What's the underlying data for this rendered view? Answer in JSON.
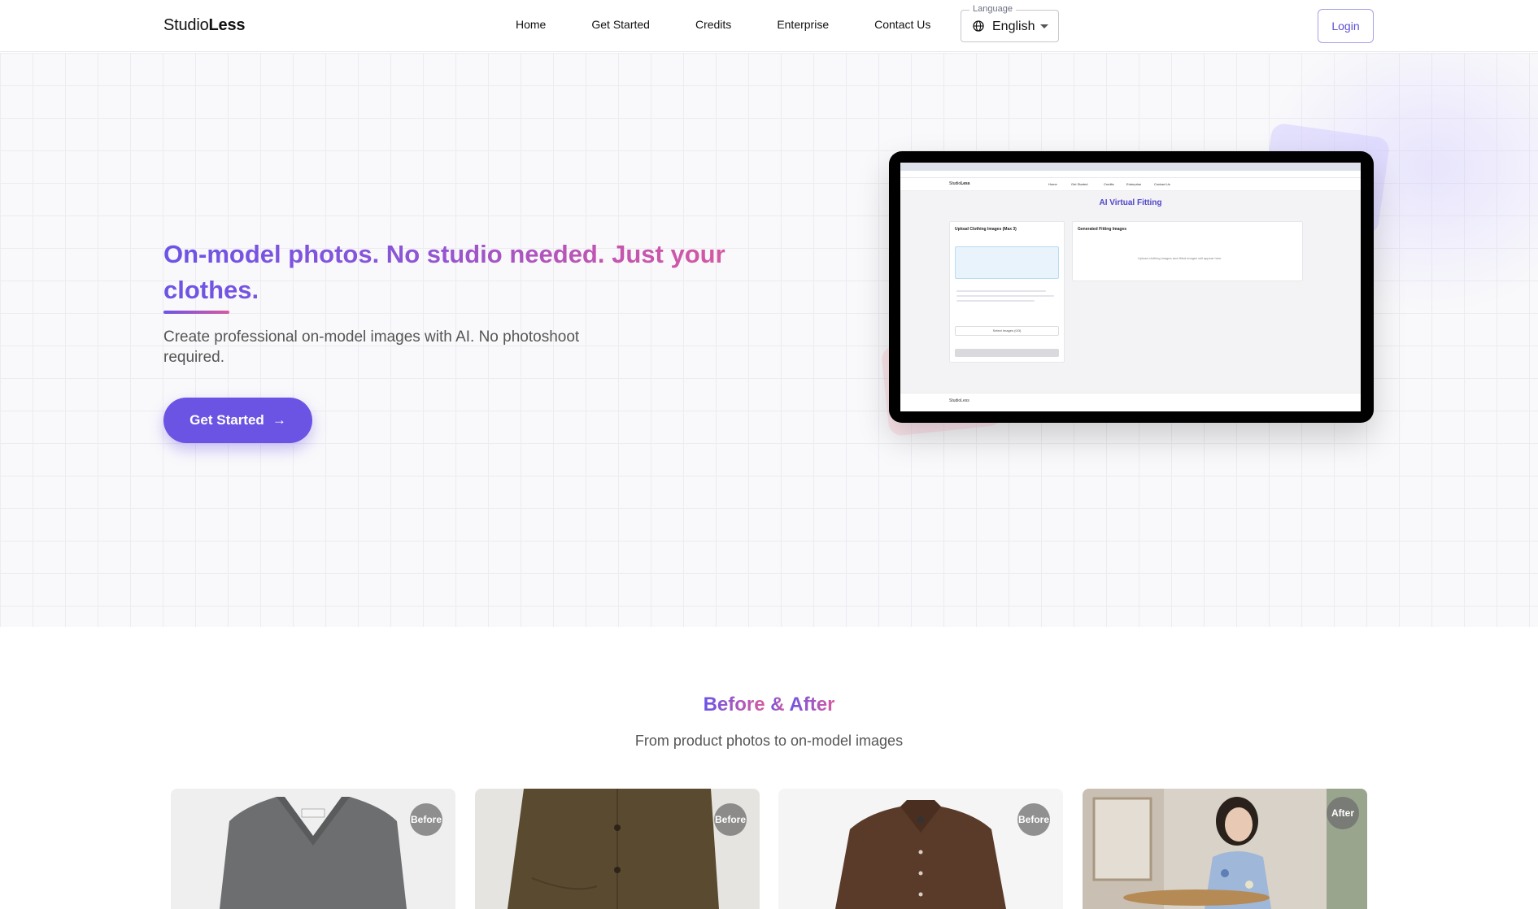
{
  "header": {
    "logo_regular": "Studio",
    "logo_bold": "Less",
    "nav": [
      "Home",
      "Get Started",
      "Credits",
      "Enterprise",
      "Contact Us"
    ],
    "language": {
      "legend": "Language",
      "value": "English",
      "icon": "globe-icon"
    },
    "login_label": "Login"
  },
  "hero": {
    "title": "On-model photos. No studio needed. Just your clothes.",
    "subtitle": "Create professional on-model images with AI. No photoshoot required.",
    "cta_label": "Get Started",
    "cta_icon": "arrow-right-icon",
    "colors": {
      "accent": "#6b54e3",
      "accent_pink": "#d75aa0"
    }
  },
  "preview": {
    "logo_regular": "Studio",
    "logo_bold": "Less",
    "nav": [
      "Home",
      "Get Started",
      "Credits",
      "Enterprise",
      "Contact Us"
    ],
    "page_title": "AI Virtual Fitting",
    "upload_card_title": "Upload Clothing Images (Max 3)",
    "generated_card_title": "Generated Fitting Images",
    "generated_placeholder": "Upload clothing images and fitted images will appear here",
    "select_button": "Select Images (0/3)",
    "footer_logo": "StudioLess"
  },
  "before_after": {
    "title_part1": "Before",
    "title_amp": "&",
    "title_part2": "After",
    "subtitle": "From product photos to on-model images",
    "cards": [
      {
        "badge": "Before",
        "item": "gray-sweater"
      },
      {
        "badge": "Before",
        "item": "brown-jacket"
      },
      {
        "badge": "Before",
        "item": "brown-shirt"
      },
      {
        "badge": "After",
        "item": "model-photo"
      }
    ]
  }
}
